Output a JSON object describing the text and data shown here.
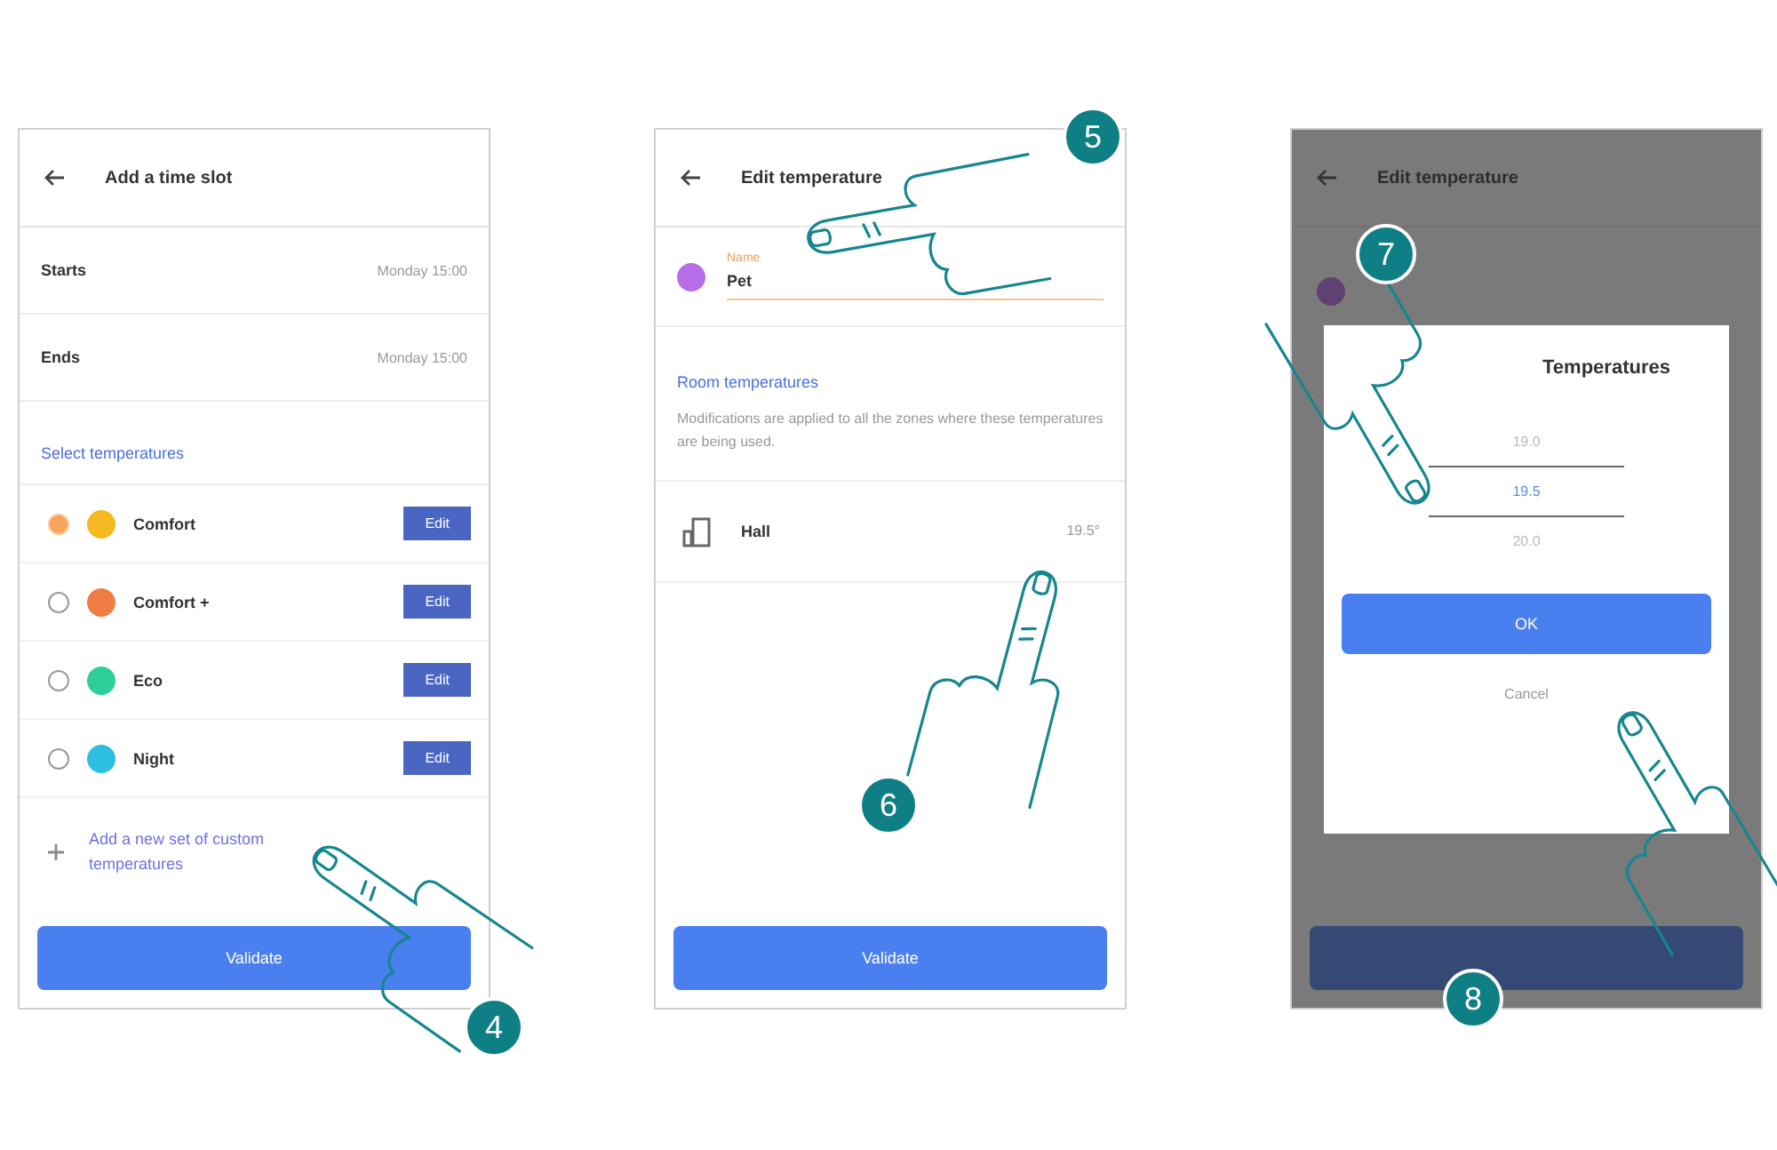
{
  "screen_1": {
    "title": "Add a time slot",
    "fields": [
      {
        "label": "Starts",
        "value": "Monday 15:00"
      },
      {
        "label": "Ends",
        "value": "Monday 15:00"
      }
    ],
    "section": "Select temperatures",
    "temperatures": [
      {
        "name": "Comfort",
        "color": "#f5b921",
        "selected": true,
        "action": "Edit"
      },
      {
        "name": "Comfort +",
        "color": "#ef7d45",
        "selected": false,
        "action": "Edit"
      },
      {
        "name": "Eco",
        "color": "#2ccf9a",
        "selected": false,
        "action": "Edit"
      },
      {
        "name": "Night",
        "color": "#2ebfe0",
        "selected": false,
        "action": "Edit"
      }
    ],
    "add_link": "Add a new set of custom temperatures",
    "button": "Validate"
  },
  "screen_2": {
    "title": "Edit temperature",
    "name_label": "Name",
    "name_value": "Pet",
    "section": "Room temperatures",
    "note": "Modifications are applied to all the zones where these temperatures are being used.",
    "rooms": [
      {
        "name": "Hall",
        "reading": "19.5°"
      }
    ],
    "button": "Validate"
  },
  "screen_3": {
    "title": "Edit temperature",
    "dialog_title": "Temperatures",
    "picker": [
      {
        "label": "19.0",
        "selected": false
      },
      {
        "label": "19.5",
        "selected": true
      },
      {
        "label": "20.0",
        "selected": false
      }
    ],
    "ok": "OK",
    "cancel": "Cancel"
  },
  "steps": [
    "4",
    "5",
    "6",
    "7",
    "8"
  ]
}
